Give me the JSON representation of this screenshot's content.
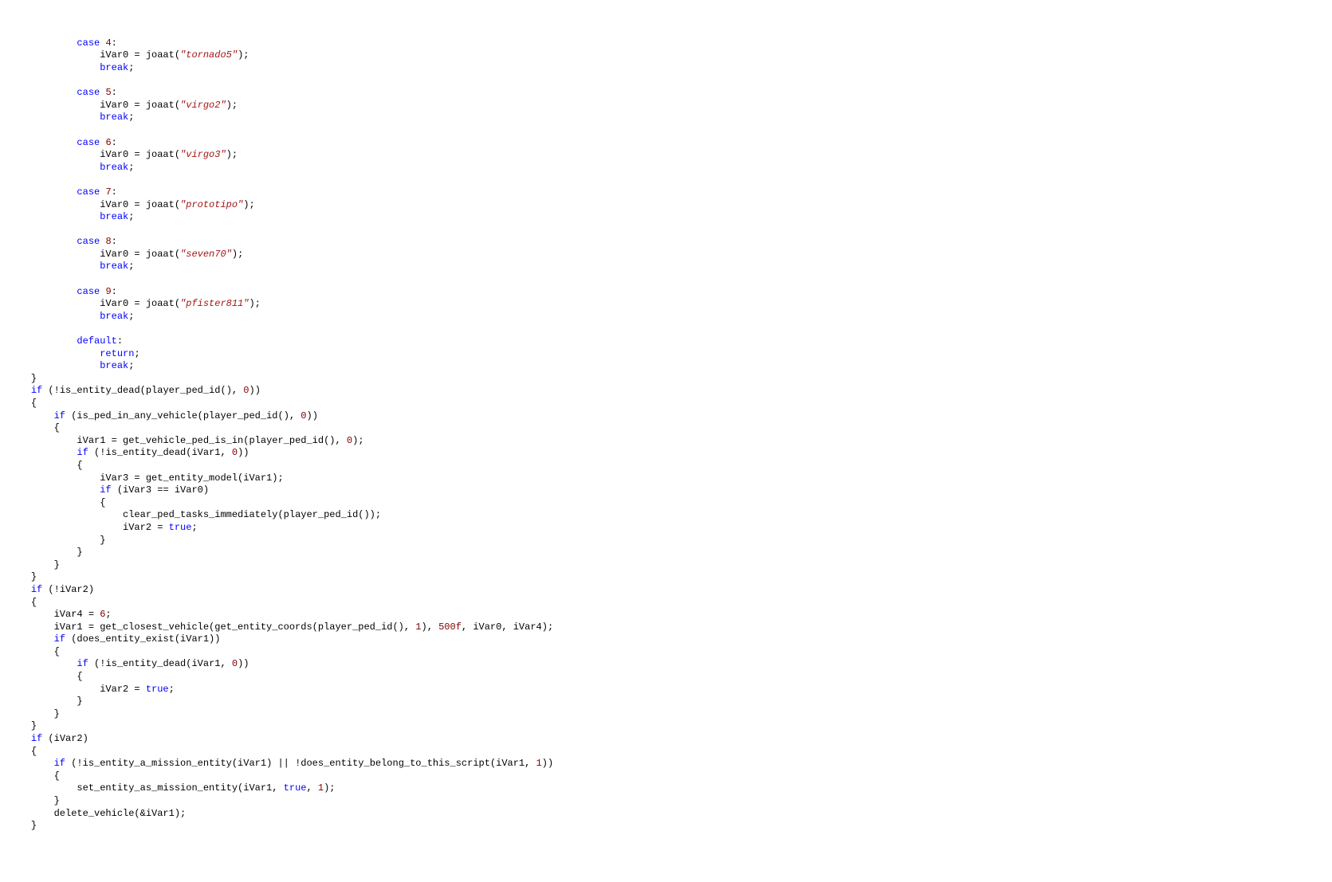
{
  "indent": "    ",
  "tokens": {
    "case": "case",
    "break": "break",
    "default": "default",
    "return": "return",
    "if": "if",
    "true": "true"
  },
  "nums": {
    "n0": "0",
    "n1": "1",
    "n4": "4",
    "n5": "5",
    "n6": "6",
    "n7": "7",
    "n8": "8",
    "n9": "9",
    "n500f": "500f"
  },
  "strs": {
    "tornado5": "\"tornado5\"",
    "virgo2": "\"virgo2\"",
    "virgo3": "\"virgo3\"",
    "prototipo": "\"prototipo\"",
    "seven70": "\"seven70\"",
    "pfister811": "\"pfister811\""
  },
  "txt": {
    "colon": ":",
    "semi": ";",
    "obrace": "{",
    "cbrace": "}",
    "opar": "(",
    "cpar": ")",
    "comma": ",",
    "eq": "=",
    "eqeq": "==",
    "amp": "&",
    "or": "||",
    "not": "!",
    "ivar0_assign_joaat": "iVar0 = joaat(",
    "is_entity_dead": "is_entity_dead",
    "player_ped_id": "player_ped_id",
    "is_ped_in_any_vehicle": "is_ped_in_any_vehicle",
    "ivar1_assign": "iVar1 = ",
    "get_vehicle_ped_is_in": "get_vehicle_ped_is_in",
    "ivar1": "iVar1",
    "ivar3_assign": "iVar3 = get_entity_model(iVar1)",
    "ivar3_eq_ivar0": "iVar3 == iVar0",
    "clear_ped_tasks": "clear_ped_tasks_immediately(player_ped_id())",
    "ivar2_assign": "iVar2 = ",
    "ivar2": "iVar2",
    "ivar4_assign": "iVar4 = ",
    "get_closest_vehicle": "get_closest_vehicle(get_entity_coords(player_ped_id(), ",
    "close_closest": "), ",
    "ivar0_ivar4": ", iVar0, iVar4)",
    "does_entity_exist": "does_entity_exist(iVar1)",
    "is_entity_a_mission_entity": "is_entity_a_mission_entity(iVar1)",
    "does_entity_belong": "does_entity_belong_to_this_script(iVar1, ",
    "set_entity_as_mission_entity": "set_entity_as_mission_entity(iVar1, ",
    "delete_vehicle": "delete_vehicle(&iVar1)",
    "sp": " "
  }
}
